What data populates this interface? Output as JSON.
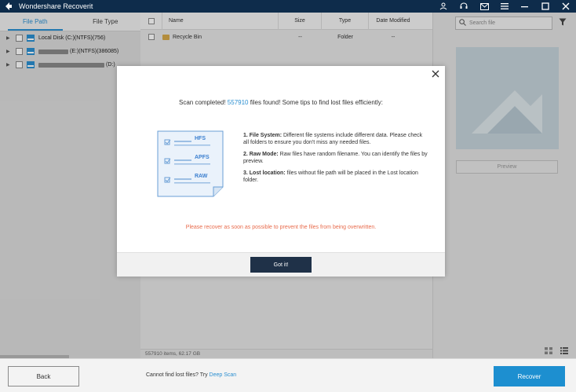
{
  "app": {
    "title": "Wondershare Recoverit"
  },
  "sidebar": {
    "tabs": [
      {
        "label": "File Path"
      },
      {
        "label": "File Type"
      }
    ],
    "drives": [
      {
        "label": "Local Disk (C:)(NTFS)(756)"
      },
      {
        "label": "(E:)(NTFS)(386085)"
      },
      {
        "label": "(D:)"
      }
    ]
  },
  "filelist": {
    "columns": {
      "name": "Name",
      "size": "Size",
      "type": "Type",
      "date": "Date Modified"
    },
    "rows": [
      {
        "name": "Recycle Bin",
        "size": "--",
        "type": "Folder",
        "date": "--"
      }
    ],
    "status": "557910 items, 62.17 GB"
  },
  "preview": {
    "search_placeholder": "Search file",
    "preview_label": "Preview"
  },
  "footer": {
    "back_label": "Back",
    "hint_text": "Cannot find lost files? Try ",
    "hint_link": "Deep Scan",
    "recover_label": "Recover"
  },
  "dialog": {
    "head_pre": "Scan completed! ",
    "count": "557910",
    "head_post": " files found! Some tips to find lost files efficiently:",
    "illus_tags": [
      "HFS",
      "APFS",
      "RAW"
    ],
    "tips": [
      {
        "title": "1. File System:",
        "text": " Different file systems include different data. Please check all folders to ensure you don't miss any needed files."
      },
      {
        "title": "2. Raw Mode:",
        "text": " Raw files have random filename. You can identify the files by preview."
      },
      {
        "title": "3. Lost location:",
        "text": " files without file path will be placed in the Lost location folder."
      }
    ],
    "warning": "Please recover as soon as possible to prevent the files from being overwritten.",
    "button": "Got it!"
  }
}
